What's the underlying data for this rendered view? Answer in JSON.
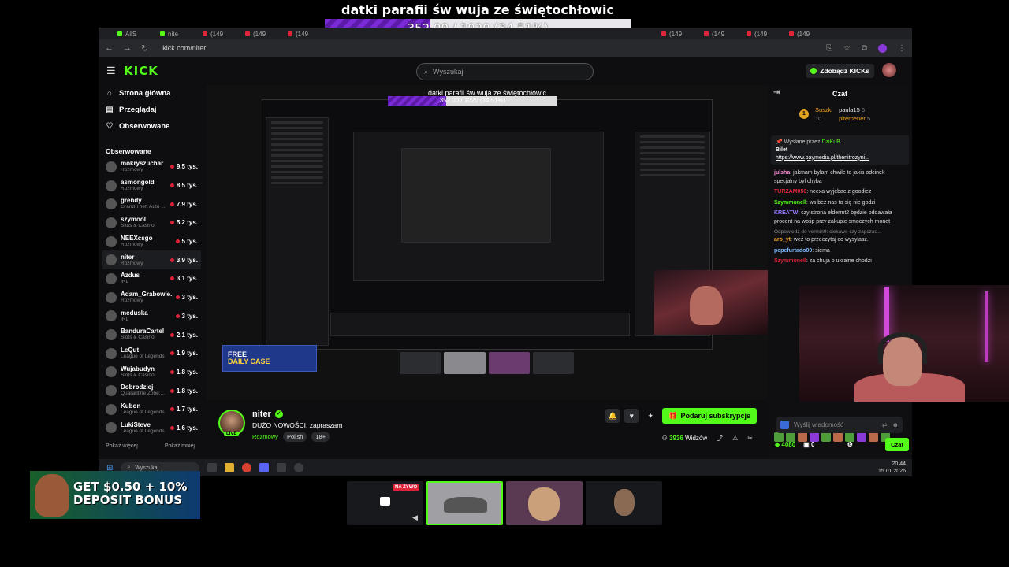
{
  "overlay": {
    "title": "datki parafii św wuja ze świętochłowic",
    "progress_text": "352.00 / 1020 (34.51%)",
    "progress_fraction": 0.3451,
    "accent": "#7a2bd6"
  },
  "browser": {
    "url": "kick.com/niter",
    "tab_label": "(149"
  },
  "kick": {
    "logo": "KICK",
    "search_placeholder": "Wyszukaj",
    "kicks_button": "Zdobądź KICKs",
    "brand_color": "#53fc18"
  },
  "sidebar": {
    "nav": [
      {
        "label": "Strona główna",
        "icon": "home-icon",
        "glyph": "⌂"
      },
      {
        "label": "Przeglądaj",
        "icon": "browse-icon",
        "glyph": "▤"
      },
      {
        "label": "Obserwowane",
        "icon": "heart-icon",
        "glyph": "♡"
      }
    ],
    "followed_title": "Obserwowane",
    "followed": [
      {
        "name": "mokryszuchar",
        "category": "Rozmowy",
        "viewers": "9,5 tys."
      },
      {
        "name": "asmongold",
        "category": "Rozmowy",
        "viewers": "8,5 tys."
      },
      {
        "name": "grendy",
        "category": "Grand Theft Auto ...",
        "viewers": "7,9 tys."
      },
      {
        "name": "szymool",
        "category": "Slots & Casino",
        "viewers": "5,2 tys."
      },
      {
        "name": "NEEXcsgo",
        "category": "Rozmowy",
        "viewers": "5 tys."
      },
      {
        "name": "niter",
        "category": "Rozmowy",
        "viewers": "3,9 tys."
      },
      {
        "name": "Azdus",
        "category": "IRL",
        "viewers": "3,1 tys."
      },
      {
        "name": "Adam_Grabowie...",
        "category": "Rozmowy",
        "viewers": "3 tys."
      },
      {
        "name": "meduska",
        "category": "IRL",
        "viewers": "3 tys."
      },
      {
        "name": "BanduraCartel",
        "category": "Slots & Casino",
        "viewers": "2,1 tys."
      },
      {
        "name": "LeQut",
        "category": "League of Legends",
        "viewers": "1,9 tys."
      },
      {
        "name": "Wujabudyn",
        "category": "Slots & Casino",
        "viewers": "1,8 tys."
      },
      {
        "name": "Dobrodziej",
        "category": "Quarantine Zone:...",
        "viewers": "1,8 tys."
      },
      {
        "name": "Kubon",
        "category": "League of Legends",
        "viewers": "1,7 tys."
      },
      {
        "name": "LukiSteve",
        "category": "League of Legends",
        "viewers": "1,6 tys."
      }
    ],
    "show_more": "Pokaż więcej",
    "show_less": "Pokaż mniej"
  },
  "player": {
    "inner_caption": "datki parafii św wuja ze świętochłowic",
    "inner_progress": "352.00 / 1020 (34.51%)",
    "free_case_line1": "FREE",
    "free_case_line2": "DAILY CASE"
  },
  "stream": {
    "streamer": "niter",
    "live_badge": "LIVE",
    "title": "DUŻO NOWOŚCI, zapraszam",
    "category": "Rozmowy",
    "tags": [
      "Polish",
      "18+"
    ],
    "subscribe_button": "Podaruj subskrypcje",
    "viewers_count": "3936",
    "viewers_label": "Widzów"
  },
  "chat": {
    "title": "Czat",
    "leaderboard": {
      "rank": "1",
      "top_name": "Suszki",
      "top_score": "10",
      "second_name": "paula15",
      "second_score": "6",
      "third_name": "piterpener",
      "third_score": "5"
    },
    "pinned": {
      "by": "Wysłane przez",
      "pinned_user": "DziKuB",
      "title": "Bilet",
      "link": "https://www.paymedia.pl/thenitrozyni..."
    },
    "messages": [
      {
        "user": "julsha",
        "color": "#ff8ad8",
        "text": "jakmam bylam chwile to jakis odcinek specjalny byl chyba"
      },
      {
        "user": "TURZAM050",
        "color": "#e0243a",
        "text": "neexa wyjebac z goodiez"
      },
      {
        "user": "Szymmonell",
        "color": "#53fc18",
        "text": "ws bez nas to się nie godzi"
      },
      {
        "user": "KREATW",
        "color": "#9a7cff",
        "text": "czy strona eldermt2 będzie oddawała procent na wośp przy zakupie smoczych monet"
      },
      {
        "reply": "Odpowiedź do vermin9: ciekawe czy zapczao..."
      },
      {
        "user": "aro_yt",
        "color": "#f0a020",
        "text": "weź to przeczytaj co wysyłasz."
      },
      {
        "user": "pepefurtado00",
        "color": "#7cb8ff",
        "text": "siema"
      },
      {
        "user": "Szymmonell",
        "color": "#e0243a",
        "text": "za chuja o ukraine chodzi"
      }
    ],
    "input_placeholder": "Wyślij wiadomość",
    "kicks_count": "4080",
    "points": "0",
    "send_button": "Czat"
  },
  "taskbar": {
    "search": "Wyszukaj",
    "time": "20:44",
    "date": "15.01.2026"
  },
  "ads": {
    "deposit_line1": "GET $0.50 + 10%",
    "deposit_line2": "DEPOSIT BONUS"
  },
  "clips": {
    "live_label": "NA ŻYWO"
  }
}
